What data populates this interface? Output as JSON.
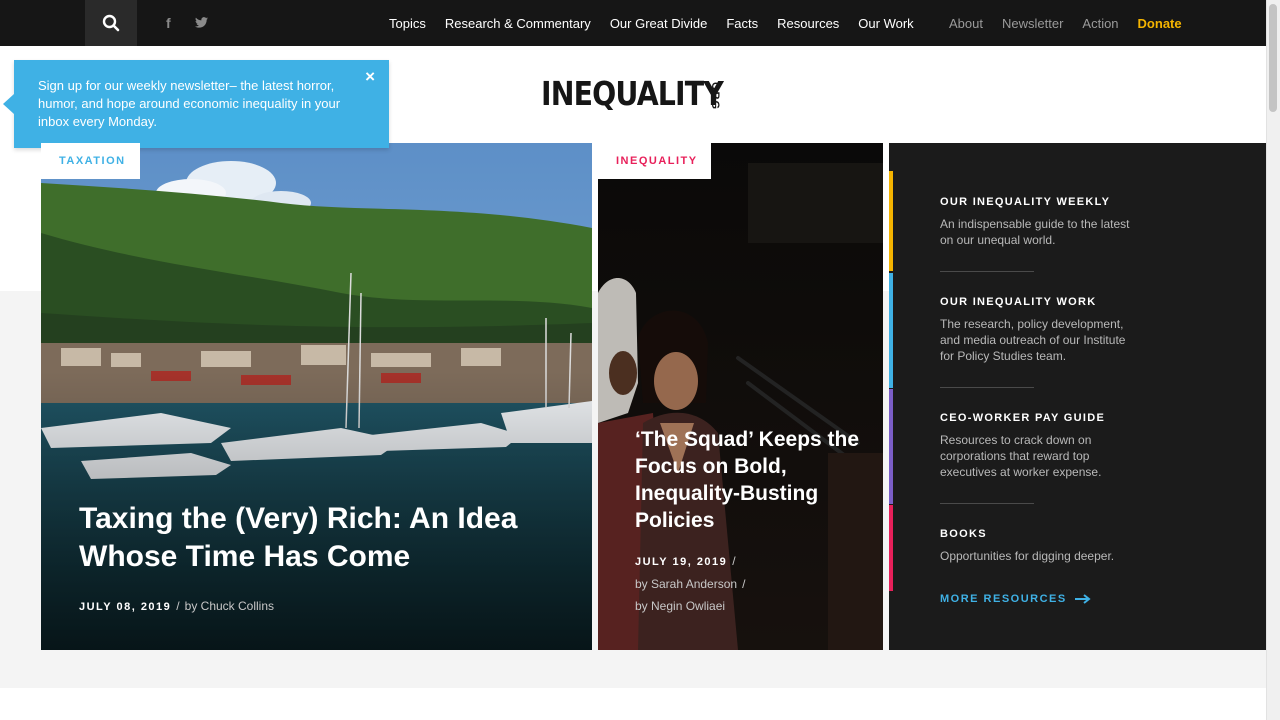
{
  "nav": {
    "main": [
      "Topics",
      "Research & Commentary",
      "Our Great Divide",
      "Facts",
      "Resources",
      "Our Work"
    ],
    "utility": [
      "About",
      "Newsletter",
      "Action"
    ],
    "donate": "Donate",
    "social": {
      "facebook": "f",
      "twitter": "twitter-icon"
    }
  },
  "logo": {
    "main": "INEQUALITY",
    "suffix": "ORG"
  },
  "popup": {
    "text": "Sign up for our weekly newsletter– the latest horror, humor, and hope around economic inequality in your inbox every Monday.",
    "close": "×"
  },
  "features": [
    {
      "tag": "TAXATION",
      "title": "Taxing the (Very) Rich: An Idea Whose Time Has Come",
      "date": "JULY 08, 2019",
      "authors": [
        "by Chuck Collins"
      ]
    },
    {
      "tag": "INEQUALITY",
      "title": "‘The Squad’ Keeps the Focus on Bold, Inequality-Busting Policies",
      "date": "JULY 19, 2019",
      "authors": [
        "by Sarah Anderson",
        "by Negin Owliaei"
      ]
    }
  ],
  "resources": {
    "items": [
      {
        "title": "OUR INEQUALITY WEEKLY",
        "desc": "An indispensable guide to the latest on our unequal world.",
        "color": "#f5b400"
      },
      {
        "title": "OUR INEQUALITY WORK",
        "desc": "The research, policy development, and media outreach of our Institute for Policy Studies team.",
        "color": "#3fb1e5"
      },
      {
        "title": "CEO-WORKER PAY GUIDE",
        "desc": "Resources to crack down on corporations that reward top executives at worker expense.",
        "color": "#7b5ec7"
      },
      {
        "title": "BOOKS",
        "desc": "Opportunities for digging deeper.",
        "color": "#e8205a"
      }
    ],
    "more": "MORE RESOURCES"
  },
  "colors": {
    "accent_blue": "#3fb1e5",
    "accent_pink": "#e8205a",
    "donate": "#f5b400",
    "dark": "#161616"
  }
}
